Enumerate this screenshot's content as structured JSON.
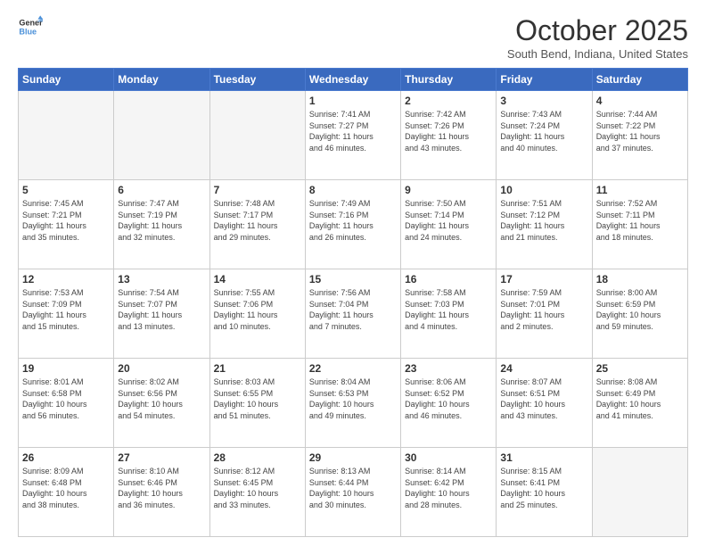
{
  "header": {
    "logo_line1": "General",
    "logo_line2": "Blue",
    "month_title": "October 2025",
    "location": "South Bend, Indiana, United States"
  },
  "days_of_week": [
    "Sunday",
    "Monday",
    "Tuesday",
    "Wednesday",
    "Thursday",
    "Friday",
    "Saturday"
  ],
  "weeks": [
    [
      {
        "day": "",
        "info": ""
      },
      {
        "day": "",
        "info": ""
      },
      {
        "day": "",
        "info": ""
      },
      {
        "day": "1",
        "info": "Sunrise: 7:41 AM\nSunset: 7:27 PM\nDaylight: 11 hours\nand 46 minutes."
      },
      {
        "day": "2",
        "info": "Sunrise: 7:42 AM\nSunset: 7:26 PM\nDaylight: 11 hours\nand 43 minutes."
      },
      {
        "day": "3",
        "info": "Sunrise: 7:43 AM\nSunset: 7:24 PM\nDaylight: 11 hours\nand 40 minutes."
      },
      {
        "day": "4",
        "info": "Sunrise: 7:44 AM\nSunset: 7:22 PM\nDaylight: 11 hours\nand 37 minutes."
      }
    ],
    [
      {
        "day": "5",
        "info": "Sunrise: 7:45 AM\nSunset: 7:21 PM\nDaylight: 11 hours\nand 35 minutes."
      },
      {
        "day": "6",
        "info": "Sunrise: 7:47 AM\nSunset: 7:19 PM\nDaylight: 11 hours\nand 32 minutes."
      },
      {
        "day": "7",
        "info": "Sunrise: 7:48 AM\nSunset: 7:17 PM\nDaylight: 11 hours\nand 29 minutes."
      },
      {
        "day": "8",
        "info": "Sunrise: 7:49 AM\nSunset: 7:16 PM\nDaylight: 11 hours\nand 26 minutes."
      },
      {
        "day": "9",
        "info": "Sunrise: 7:50 AM\nSunset: 7:14 PM\nDaylight: 11 hours\nand 24 minutes."
      },
      {
        "day": "10",
        "info": "Sunrise: 7:51 AM\nSunset: 7:12 PM\nDaylight: 11 hours\nand 21 minutes."
      },
      {
        "day": "11",
        "info": "Sunrise: 7:52 AM\nSunset: 7:11 PM\nDaylight: 11 hours\nand 18 minutes."
      }
    ],
    [
      {
        "day": "12",
        "info": "Sunrise: 7:53 AM\nSunset: 7:09 PM\nDaylight: 11 hours\nand 15 minutes."
      },
      {
        "day": "13",
        "info": "Sunrise: 7:54 AM\nSunset: 7:07 PM\nDaylight: 11 hours\nand 13 minutes."
      },
      {
        "day": "14",
        "info": "Sunrise: 7:55 AM\nSunset: 7:06 PM\nDaylight: 11 hours\nand 10 minutes."
      },
      {
        "day": "15",
        "info": "Sunrise: 7:56 AM\nSunset: 7:04 PM\nDaylight: 11 hours\nand 7 minutes."
      },
      {
        "day": "16",
        "info": "Sunrise: 7:58 AM\nSunset: 7:03 PM\nDaylight: 11 hours\nand 4 minutes."
      },
      {
        "day": "17",
        "info": "Sunrise: 7:59 AM\nSunset: 7:01 PM\nDaylight: 11 hours\nand 2 minutes."
      },
      {
        "day": "18",
        "info": "Sunrise: 8:00 AM\nSunset: 6:59 PM\nDaylight: 10 hours\nand 59 minutes."
      }
    ],
    [
      {
        "day": "19",
        "info": "Sunrise: 8:01 AM\nSunset: 6:58 PM\nDaylight: 10 hours\nand 56 minutes."
      },
      {
        "day": "20",
        "info": "Sunrise: 8:02 AM\nSunset: 6:56 PM\nDaylight: 10 hours\nand 54 minutes."
      },
      {
        "day": "21",
        "info": "Sunrise: 8:03 AM\nSunset: 6:55 PM\nDaylight: 10 hours\nand 51 minutes."
      },
      {
        "day": "22",
        "info": "Sunrise: 8:04 AM\nSunset: 6:53 PM\nDaylight: 10 hours\nand 49 minutes."
      },
      {
        "day": "23",
        "info": "Sunrise: 8:06 AM\nSunset: 6:52 PM\nDaylight: 10 hours\nand 46 minutes."
      },
      {
        "day": "24",
        "info": "Sunrise: 8:07 AM\nSunset: 6:51 PM\nDaylight: 10 hours\nand 43 minutes."
      },
      {
        "day": "25",
        "info": "Sunrise: 8:08 AM\nSunset: 6:49 PM\nDaylight: 10 hours\nand 41 minutes."
      }
    ],
    [
      {
        "day": "26",
        "info": "Sunrise: 8:09 AM\nSunset: 6:48 PM\nDaylight: 10 hours\nand 38 minutes."
      },
      {
        "day": "27",
        "info": "Sunrise: 8:10 AM\nSunset: 6:46 PM\nDaylight: 10 hours\nand 36 minutes."
      },
      {
        "day": "28",
        "info": "Sunrise: 8:12 AM\nSunset: 6:45 PM\nDaylight: 10 hours\nand 33 minutes."
      },
      {
        "day": "29",
        "info": "Sunrise: 8:13 AM\nSunset: 6:44 PM\nDaylight: 10 hours\nand 30 minutes."
      },
      {
        "day": "30",
        "info": "Sunrise: 8:14 AM\nSunset: 6:42 PM\nDaylight: 10 hours\nand 28 minutes."
      },
      {
        "day": "31",
        "info": "Sunrise: 8:15 AM\nSunset: 6:41 PM\nDaylight: 10 hours\nand 25 minutes."
      },
      {
        "day": "",
        "info": ""
      }
    ]
  ]
}
